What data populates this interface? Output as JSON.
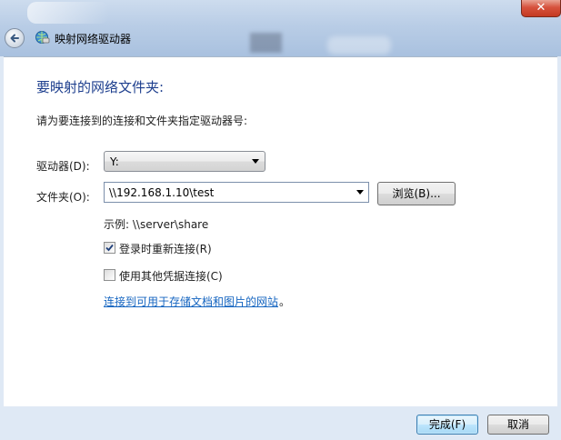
{
  "window": {
    "title": "映射网络驱动器",
    "close_glyph": "✕"
  },
  "content": {
    "heading": "要映射的网络文件夹:",
    "instruction": "请为要连接到的连接和文件夹指定驱动器号:",
    "drive_label": "驱动器(D):",
    "drive_value": "Y:",
    "folder_label": "文件夹(O):",
    "folder_value": "\\\\192.168.1.10\\test",
    "browse_label": "浏览(B)...",
    "example": "示例: \\\\server\\share",
    "reconnect_label": "登录时重新连接(R)",
    "reconnect_checked": true,
    "credentials_label": "使用其他凭据连接(C)",
    "credentials_checked": false,
    "link_text": "连接到可用于存储文档和图片的网站",
    "link_suffix": "。"
  },
  "footer": {
    "finish_label": "完成(F)",
    "cancel_label": "取消"
  },
  "colors": {
    "heading": "#1e3f8e",
    "link": "#1565c0",
    "close_button": "#c43a22"
  }
}
